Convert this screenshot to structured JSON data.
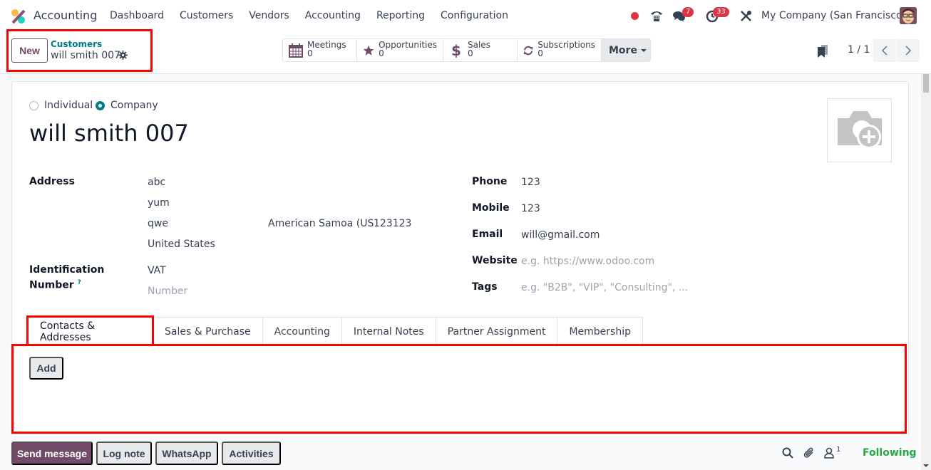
{
  "navbar": {
    "app_name": "Accounting",
    "menu": [
      "Dashboard",
      "Customers",
      "Vendors",
      "Accounting",
      "Reporting",
      "Configuration"
    ],
    "chat_badge": "7",
    "activity_badge": "33",
    "company": "My Company (San Francisco)",
    "icons": [
      "status-dot",
      "phone-icon",
      "chat-icon",
      "clock-icon",
      "tools-icon",
      "avatar"
    ]
  },
  "control_panel": {
    "new_label": "New",
    "breadcrumb_parent": "Customers",
    "breadcrumb_current": "will smith 007",
    "smart_buttons": [
      {
        "label": "Meetings",
        "value": "0",
        "icon": "calendar-icon"
      },
      {
        "label": "Opportunities",
        "value": "0",
        "icon": "star-icon"
      },
      {
        "label": "Sales",
        "value": "0",
        "icon": "dollar-icon"
      },
      {
        "label": "Subscriptions",
        "value": "0",
        "icon": "refresh-icon"
      }
    ],
    "more_label": "More",
    "pager": "1 / 1"
  },
  "form": {
    "type_options": [
      "Individual",
      "Company"
    ],
    "type_selected": "Company",
    "name": "will smith 007",
    "address_label": "Address",
    "street": "abc",
    "street2": "yum",
    "city": "qwe",
    "state": "American Samoa (US",
    "zip": "123123",
    "country": "United States",
    "id_label_line1": "Identification",
    "id_label_line2": "Number",
    "id_help": "?",
    "id_type": "VAT",
    "id_number_placeholder": "Number",
    "phone_label": "Phone",
    "phone": "123",
    "mobile_label": "Mobile",
    "mobile": "123",
    "email_label": "Email",
    "email": "will@gmail.com",
    "website_label": "Website",
    "website_placeholder": "e.g. https://www.odoo.com",
    "tags_label": "Tags",
    "tags_placeholder": "e.g. \"B2B\", \"VIP\", \"Consulting\", ..."
  },
  "tabs": [
    "Contacts & Addresses",
    "Sales & Purchase",
    "Accounting",
    "Internal Notes",
    "Partner Assignment",
    "Membership"
  ],
  "active_tab": "Contacts & Addresses",
  "tab_content": {
    "add_label": "Add"
  },
  "chatter": {
    "send_message": "Send message",
    "log_note": "Log note",
    "whatsapp": "WhatsApp",
    "activities": "Activities",
    "followers_count": "1",
    "following": "Following"
  },
  "colors": {
    "brand": "#714B67",
    "teal": "#017e84",
    "highlight": "#ff0000",
    "following": "#28a745"
  }
}
